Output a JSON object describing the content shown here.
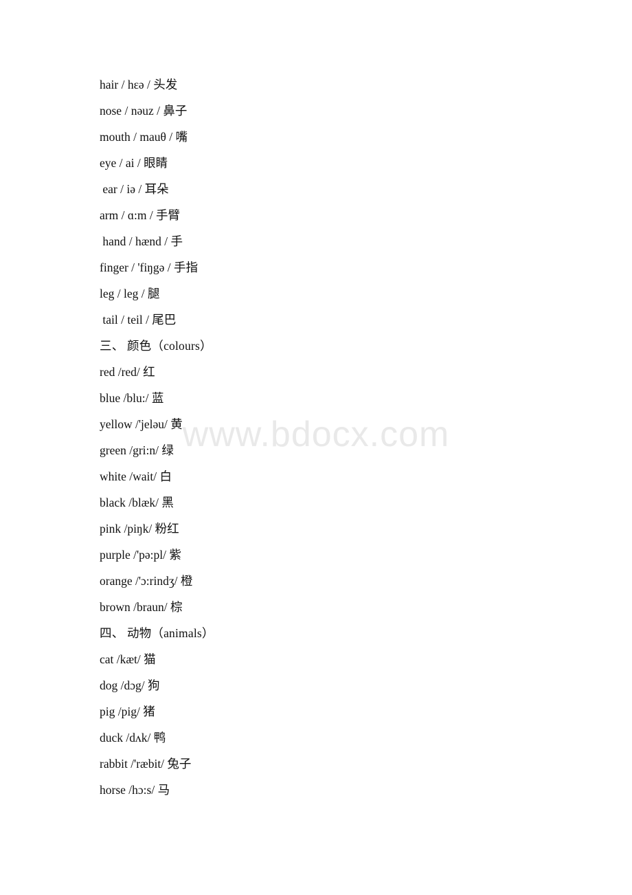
{
  "page": {
    "background_color": "#ffffff",
    "text_color": "#111111"
  },
  "watermark": {
    "text": "www.bdocx.com",
    "color": "#e9e9e9"
  },
  "lines": [
    {
      "id": "body-hair",
      "text": "hair / hɛə / 头发"
    },
    {
      "id": "body-nose",
      "text": "nose / nəuz / 鼻子"
    },
    {
      "id": "body-mouth",
      "text": "mouth / mauθ / 嘴"
    },
    {
      "id": "body-eye",
      "text": "eye / ai / 眼睛"
    },
    {
      "id": "body-ear",
      "text": " ear / iə / 耳朵"
    },
    {
      "id": "body-arm",
      "text": "arm / ɑ:m / 手臂"
    },
    {
      "id": "body-hand",
      "text": " hand / hænd / 手"
    },
    {
      "id": "body-finger",
      "text": "finger / 'fiŋgə / 手指"
    },
    {
      "id": "body-leg",
      "text": "leg / leg / 腿"
    },
    {
      "id": "body-tail",
      "text": " tail / teil / 尾巴"
    },
    {
      "id": "heading-colours",
      "text": "三、 颜色（colours）",
      "heading": true
    },
    {
      "id": "colour-red",
      "text": "red /red/ 红"
    },
    {
      "id": "colour-blue",
      "text": "blue /blu:/ 蓝"
    },
    {
      "id": "colour-yellow",
      "text": "yellow /'jeləu/ 黄"
    },
    {
      "id": "colour-green",
      "text": "green /gri:n/ 绿"
    },
    {
      "id": "colour-white",
      "text": "white /wait/ 白"
    },
    {
      "id": "colour-black",
      "text": "black /blæk/ 黑"
    },
    {
      "id": "colour-pink",
      "text": "pink /piŋk/ 粉红"
    },
    {
      "id": "colour-purple",
      "text": "purple /'pə:pl/ 紫"
    },
    {
      "id": "colour-orange",
      "text": "orange /'ɔ:rindʒ/ 橙"
    },
    {
      "id": "colour-brown",
      "text": "brown /braun/ 棕"
    },
    {
      "id": "heading-animals",
      "text": "四、 动物（animals）",
      "heading": true
    },
    {
      "id": "animal-cat",
      "text": "cat /kæt/ 猫"
    },
    {
      "id": "animal-dog",
      "text": "dog /dɔg/ 狗"
    },
    {
      "id": "animal-pig",
      "text": "pig /pig/ 猪"
    },
    {
      "id": "animal-duck",
      "text": "duck /dʌk/ 鸭"
    },
    {
      "id": "animal-rabbit",
      "text": "rabbit /'ræbit/ 兔子"
    },
    {
      "id": "animal-horse",
      "text": "horse /hɔ:s/ 马"
    }
  ]
}
